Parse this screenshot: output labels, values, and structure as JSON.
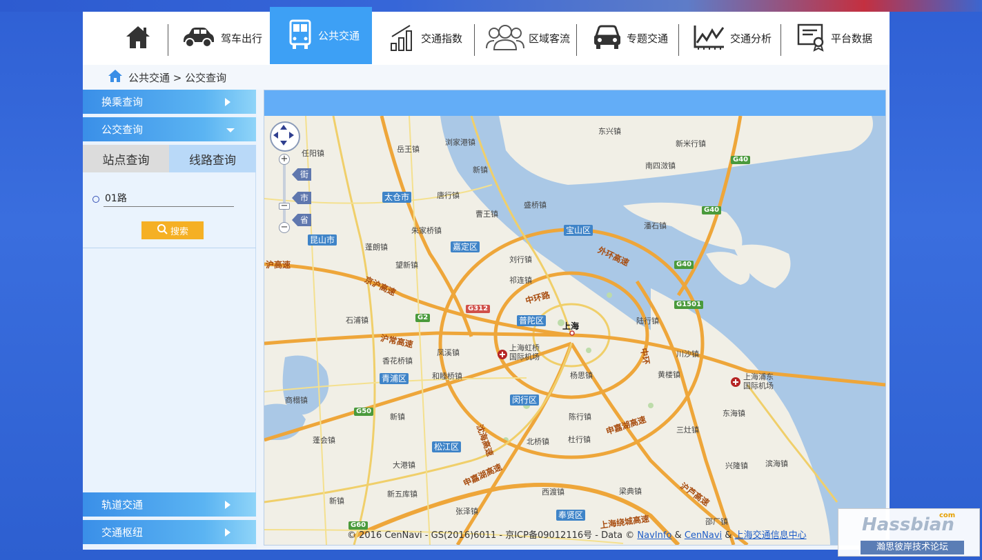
{
  "nav": {
    "items": [
      {
        "label": ""
      },
      {
        "label": "驾车出行"
      },
      {
        "label": "公共交通"
      },
      {
        "label": "交通指数"
      },
      {
        "label": "区域客流"
      },
      {
        "label": "专题交通"
      },
      {
        "label": "交通分析"
      },
      {
        "label": "平台数据"
      }
    ],
    "active": "公共交通"
  },
  "breadcrumb": {
    "text": "公共交通 > 公交查询"
  },
  "sidebar": {
    "sections": [
      {
        "label": "换乘查询"
      },
      {
        "label": "公交查询"
      },
      {
        "label": "轨道交通"
      },
      {
        "label": "交通枢纽"
      }
    ],
    "tabs": [
      {
        "label": "站点查询"
      },
      {
        "label": "线路查询"
      }
    ],
    "route_input": {
      "value": "01路",
      "placeholder": ""
    },
    "search_button": "搜索"
  },
  "map": {
    "zoom_levels": [
      "街",
      "市",
      "省"
    ],
    "districts": [
      "太仓市",
      "宝山区",
      "嘉定区",
      "昆山市",
      "普陀区",
      "青浦区",
      "闵行区",
      "松江区",
      "奉贤区"
    ],
    "towns": [
      "岳王镇",
      "浏家港镇",
      "东兴镇",
      "新米行镇",
      "任阳镇",
      "新镇",
      "南四滧镇",
      "唐行镇",
      "曹王镇",
      "盛桥镇",
      "潘石镇",
      "朱家桥镇",
      "蓬朗镇",
      "刘行镇",
      "望新镇",
      "祁连镇",
      "石浦镇",
      "陆行镇",
      "香花桥镇",
      "凤溪镇",
      "川沙镇",
      "和睦桥镇",
      "杨思镇",
      "黄楼镇",
      "商榻镇",
      "新镇",
      "陈行镇",
      "东海镇",
      "蓬会镇",
      "北桥镇",
      "杜行镇",
      "三灶镇",
      "大港镇",
      "兴隆镇",
      "滨海镇",
      "新镇",
      "新五库镇",
      "西渡镇",
      "梁典镇",
      "张泽镇",
      "邵厂镇"
    ],
    "city": "上海",
    "airports": [
      "上海虹桥国际机场",
      "上海浦东国际机场"
    ],
    "highways": [
      "G40",
      "G40",
      "G40",
      "G1501",
      "G2",
      "G312",
      "G50",
      "G60"
    ],
    "roads": [
      "外环高速",
      "中环路",
      "京沪高速",
      "沪常高速",
      "沪高速",
      "申嘉湖高速",
      "沈海高速",
      "申嘉湖高速",
      "上海绕城高速",
      "沪芦高速",
      "中环"
    ],
    "copyright": {
      "prefix": "© 2016 CenNavi - GS(2016)6011 - 京ICP备09012116号 - Data ©",
      "link1": "NavInfo",
      "amp": "&",
      "link2": "CenNavi",
      "link3": "上海交通信息中心"
    }
  },
  "watermark": {
    "main": "Hassbian",
    "com": "com",
    "sub": "瀚思彼岸技术论坛"
  },
  "colors": {
    "nav_active": "#3da0f5",
    "accordion": "#4a9ef0",
    "search_button": "#f5b024",
    "map_header": "#63adf7"
  }
}
